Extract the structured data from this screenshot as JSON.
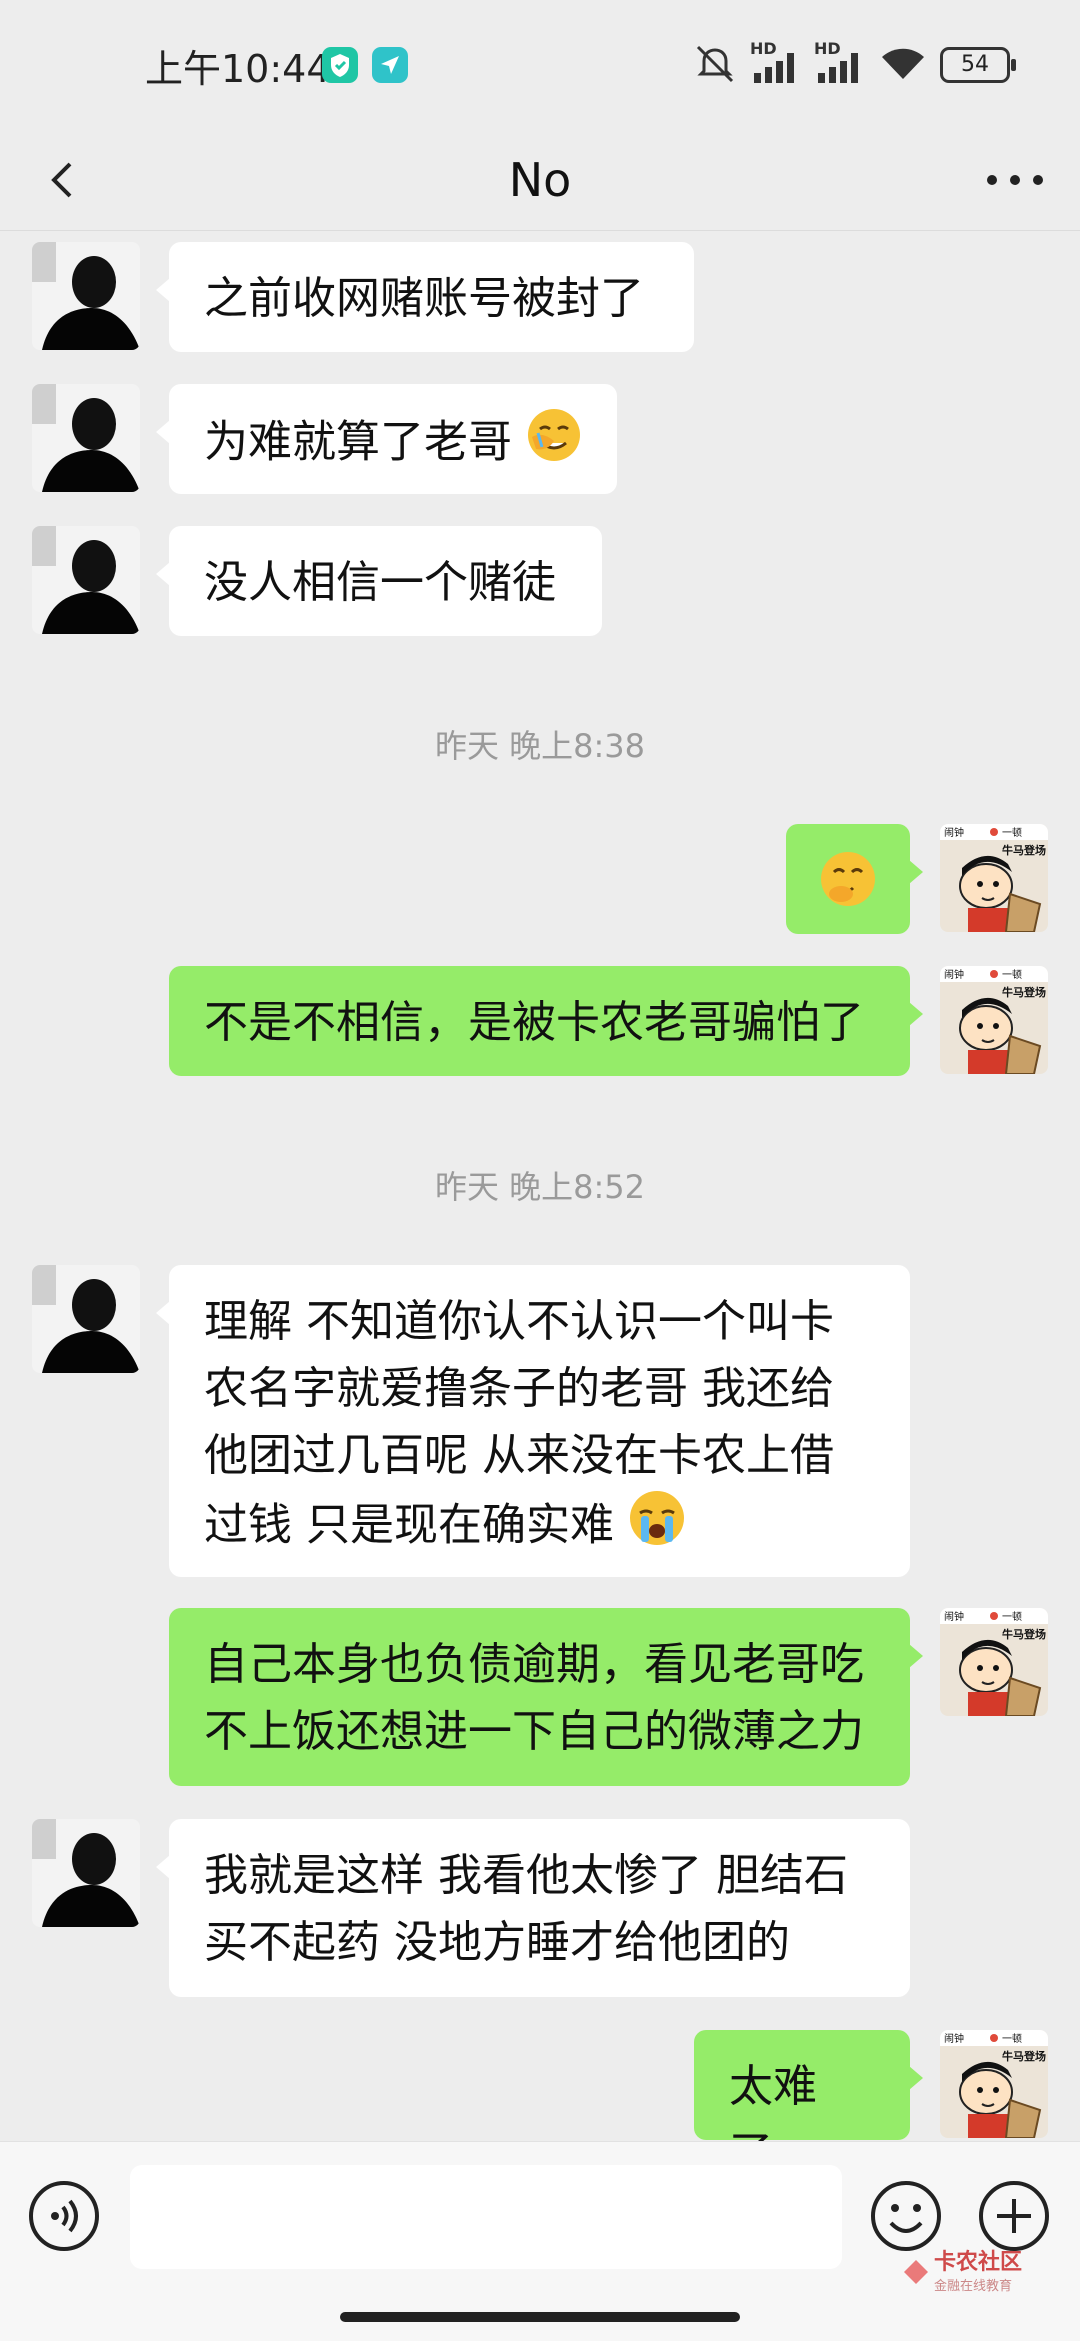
{
  "status_bar": {
    "time": "上午10:44",
    "network_1": "HD",
    "network_2": "HD",
    "battery": "54"
  },
  "header": {
    "title": "No"
  },
  "messages": [
    {
      "side": "in",
      "text": "之前收网赌账号被封了"
    },
    {
      "side": "in",
      "text": "为难就算了老哥",
      "emoji": "facepalm-emoji"
    },
    {
      "side": "in",
      "text": "没人相信一个赌徒"
    },
    {
      "type": "timestamp",
      "text": "昨天 晚上8:38"
    },
    {
      "side": "out",
      "text": "",
      "emoji": "giggle-emoji"
    },
    {
      "side": "out",
      "text": "不是不相信，是被卡农老哥骗怕了"
    },
    {
      "type": "timestamp",
      "text": "昨天 晚上8:52"
    },
    {
      "side": "in",
      "lines": [
        "理解 不知道你认不认识一个叫卡",
        "农名字就爱撸条子的老哥 我还给",
        "他团过几百呢 从来没在卡农上借",
        "过钱 只是现在确实难"
      ],
      "emoji": "crying-emoji"
    },
    {
      "side": "out",
      "lines": [
        "自己本身也负债逾期，看见老哥吃",
        "不上饭还想进一下自己的微薄之力"
      ]
    },
    {
      "side": "in",
      "lines": [
        "我就是这样 我看他太惨了 胆结石",
        "买不起药 没地方睡才给他团的"
      ]
    },
    {
      "side": "out",
      "text": "太难了，"
    }
  ],
  "self_avatar": {
    "caption_left": "闹钟",
    "caption_mid": "一顿",
    "caption_right": "牛马登场"
  },
  "input": {
    "placeholder": ""
  },
  "watermark": {
    "title": "卡农社区",
    "subtitle": "金融在线教育"
  },
  "colors": {
    "background": "#ededed",
    "bubble_in": "#ffffff",
    "bubble_out": "#95ec69"
  }
}
